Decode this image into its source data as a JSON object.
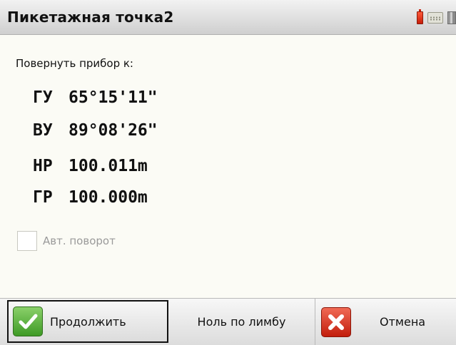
{
  "window": {
    "title": "Пикетажная точка2"
  },
  "tray": {
    "icons": [
      "battery-icon",
      "keyboard-icon",
      "connection-icon"
    ]
  },
  "content": {
    "prompt": "Повернуть прибор к:",
    "measurements": [
      {
        "label": "ГУ",
        "value": "65°15'11\""
      },
      {
        "label": "ВУ",
        "value": "89°08'26\""
      },
      {
        "label": "НР",
        "value": "100.011m"
      },
      {
        "label": "ГР",
        "value": "100.000m"
      }
    ],
    "auto_rotate": {
      "label": "Авт. поворот",
      "checked": false,
      "enabled": false
    }
  },
  "buttons": {
    "continue": "Продолжить",
    "zero_limb": "Ноль по лимбу",
    "cancel": "Отмена"
  },
  "colors": {
    "accept_green": "#3e9a25",
    "cancel_red": "#c21d0c",
    "battery_red": "#c61c08",
    "disabled_text": "#9a9a9a"
  }
}
